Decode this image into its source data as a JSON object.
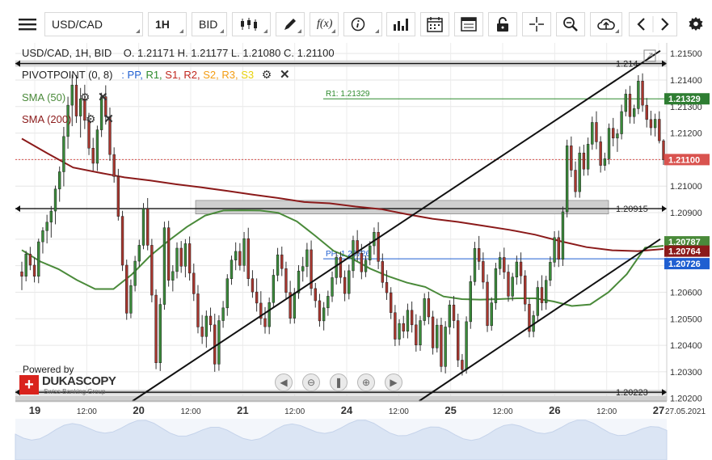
{
  "toolbar": {
    "instrument": "USD/CAD",
    "timeframe": "1H",
    "side": "BID",
    "fx_label": "f(x)",
    "info_label": "i"
  },
  "legend": {
    "ohlc_prefix": "USD/CAD, 1H, BID",
    "ohlc": "O. 1.21171 H. 1.21177 L. 1.21080 C. 1.21100",
    "pivot_name": "PIVOTPOINT (0, 8)",
    "pivot_sep": ":",
    "pivot_levels": [
      {
        "label": "PP",
        "color": "#1f5fd1"
      },
      {
        "label": "R1",
        "color": "#2e8b2e"
      },
      {
        "label": "S1",
        "color": "#c0271e"
      },
      {
        "label": "R2",
        "color": "#c0271e"
      },
      {
        "label": "S2",
        "color": "#f39c12"
      },
      {
        "label": "R3",
        "color": "#f39c12"
      },
      {
        "label": "S3",
        "color": "#e8d10a"
      }
    ],
    "sma50": "SMA (50)",
    "sma200": "SMA (200)",
    "sma50_color": "#4a8a3a",
    "sma200_color": "#8b1a1a"
  },
  "branding": {
    "powered": "Powered by",
    "logo_word": "DUKASCOPY",
    "logo_sub": "Swiss Banking Group"
  },
  "chart_data": {
    "type": "candlestick",
    "instrument": "USD/CAD",
    "timeframe": "1H",
    "ylim": [
      1.2019,
      1.2154
    ],
    "y_ticks": [
      "1.21500",
      "1.21400",
      "1.21300",
      "1.21200",
      "1.21100",
      "1.21000",
      "1.20900",
      "1.20800",
      "1.20700",
      "1.20600",
      "1.20500",
      "1.20400",
      "1.20300",
      "1.20200"
    ],
    "x_ticks": [
      {
        "label": "19",
        "bold": true
      },
      {
        "label": "12:00",
        "bold": false
      },
      {
        "label": "20",
        "bold": true
      },
      {
        "label": "12:00",
        "bold": false
      },
      {
        "label": "21",
        "bold": true
      },
      {
        "label": "12:00",
        "bold": false
      },
      {
        "label": "24",
        "bold": true
      },
      {
        "label": "12:00",
        "bold": false
      },
      {
        "label": "25",
        "bold": true
      },
      {
        "label": "12:00",
        "bold": false
      },
      {
        "label": "26",
        "bold": true
      },
      {
        "label": "12:00",
        "bold": false
      },
      {
        "label": "27",
        "bold": true
      }
    ],
    "date_label": "27.05.2021",
    "horizontal_levels": [
      {
        "value": 1.21462,
        "label": "1.214"
      },
      {
        "value": 1.20915,
        "label": "1.20915"
      },
      {
        "value": 1.20223,
        "label": "1.20223"
      }
    ],
    "pivot_r1": {
      "value": 1.21329,
      "label": "R1: 1.21329",
      "color": "#2e8b2e"
    },
    "pivot_pp": {
      "value": 1.20726,
      "label": "PP: 1.20726",
      "color": "#1f5fd1"
    },
    "price_tags": [
      {
        "value": 1.21329,
        "text": "1.21329",
        "color": "#2e7d32"
      },
      {
        "value": 1.211,
        "text": "1.21100",
        "color": "#d9534f"
      },
      {
        "value": 1.20787,
        "text": "1.20787",
        "color": "#4a8a3a"
      },
      {
        "value": 1.20764,
        "text": "1.20764",
        "color": "#8b1a1a"
      },
      {
        "value": 1.20726,
        "text": "1.20726",
        "color": "#1f5fd1"
      }
    ],
    "sma50_path": [
      [
        0.0,
        1.20759
      ],
      [
        1,
        1.20716
      ],
      [
        2,
        1.20687
      ],
      [
        3,
        1.20646
      ],
      [
        4,
        1.20612
      ],
      [
        5,
        1.20612
      ],
      [
        6,
        1.20667
      ],
      [
        7,
        1.20737
      ],
      [
        8,
        1.20794
      ],
      [
        9,
        1.20846
      ],
      [
        10,
        1.20889
      ],
      [
        11,
        1.20908
      ],
      [
        12,
        1.20909
      ],
      [
        13,
        1.20908
      ],
      [
        14,
        1.20899
      ],
      [
        15,
        1.20867
      ],
      [
        16,
        1.20813
      ],
      [
        17,
        1.20756
      ],
      [
        18,
        1.20727
      ],
      [
        19,
        1.20689
      ],
      [
        20,
        1.2066
      ],
      [
        21,
        1.20636
      ],
      [
        22,
        1.2062
      ],
      [
        23,
        1.20584
      ],
      [
        24,
        1.20574
      ],
      [
        25,
        1.20572
      ],
      [
        26,
        1.20574
      ],
      [
        27,
        1.20577
      ],
      [
        28,
        1.20577
      ],
      [
        29,
        1.20565
      ],
      [
        30,
        1.20548
      ],
      [
        31,
        1.20554
      ],
      [
        32,
        1.206
      ],
      [
        33,
        1.20668
      ],
      [
        34,
        1.20768
      ],
      [
        35,
        1.20775
      ]
    ],
    "sma200_path": [
      [
        0.0,
        1.21179
      ],
      [
        1,
        1.21123
      ],
      [
        2,
        1.2107
      ],
      [
        3,
        1.21051
      ],
      [
        4,
        1.21033
      ],
      [
        5,
        1.21021
      ],
      [
        6,
        1.21007
      ],
      [
        7,
        1.20995
      ],
      [
        8,
        1.20982
      ],
      [
        9,
        1.20968
      ],
      [
        10,
        1.20955
      ],
      [
        11,
        1.2094
      ],
      [
        12,
        1.20935
      ],
      [
        13,
        1.20923
      ],
      [
        14,
        1.20913
      ],
      [
        15,
        1.20894
      ],
      [
        16,
        1.20877
      ],
      [
        17,
        1.20865
      ],
      [
        18,
        1.2085
      ],
      [
        19,
        1.20835
      ],
      [
        20,
        1.20817
      ],
      [
        21,
        1.20792
      ],
      [
        22,
        1.2077
      ],
      [
        23,
        1.20758
      ],
      [
        24,
        1.20755
      ],
      [
        25,
        1.20763
      ]
    ],
    "trendlines": [
      {
        "from": [
          1.2019,
          0.18
        ],
        "to": [
          1.2151,
          0.99
        ]
      },
      {
        "from": [
          1.2019,
          0.62
        ],
        "to": [
          1.208,
          0.99
        ]
      }
    ],
    "candles": [
      [
        1.20677,
        1.20715,
        1.20608,
        1.2066
      ],
      [
        1.2066,
        1.20756,
        1.20641,
        1.20744
      ],
      [
        1.20744,
        1.20771,
        1.20683,
        1.20702
      ],
      [
        1.20702,
        1.20731,
        1.20637,
        1.2066
      ],
      [
        1.2066,
        1.20802,
        1.20634,
        1.2079
      ],
      [
        1.2079,
        1.20845,
        1.20746,
        1.20832
      ],
      [
        1.20832,
        1.20892,
        1.20784,
        1.20864
      ],
      [
        1.20864,
        1.20925,
        1.20806,
        1.20906
      ],
      [
        1.20906,
        1.21002,
        1.20856,
        1.20989
      ],
      [
        1.20989,
        1.21074,
        1.20941,
        1.21054
      ],
      [
        1.21054,
        1.21223,
        1.20999,
        1.21187
      ],
      [
        1.21187,
        1.21337,
        1.21141,
        1.21305
      ],
      [
        1.21305,
        1.2142,
        1.21226,
        1.21381
      ],
      [
        1.21381,
        1.21418,
        1.21238,
        1.21264
      ],
      [
        1.21264,
        1.2137,
        1.21183,
        1.21329
      ],
      [
        1.21329,
        1.21382,
        1.21215,
        1.21248
      ],
      [
        1.21248,
        1.21276,
        1.21117,
        1.21143
      ],
      [
        1.21143,
        1.21182,
        1.21058,
        1.21086
      ],
      [
        1.21086,
        1.21228,
        1.21057,
        1.21212
      ],
      [
        1.21212,
        1.21352,
        1.21185,
        1.21337
      ],
      [
        1.21337,
        1.2138,
        1.21232,
        1.21262
      ],
      [
        1.21262,
        1.21296,
        1.21095,
        1.21119
      ],
      [
        1.21119,
        1.21146,
        1.21013,
        1.21036
      ],
      [
        1.21036,
        1.21065,
        1.2087,
        1.20886
      ],
      [
        1.20886,
        1.20907,
        1.2068,
        1.20702
      ],
      [
        1.20702,
        1.20723,
        1.20496,
        1.20521
      ],
      [
        1.20521,
        1.20648,
        1.20502,
        1.20625
      ],
      [
        1.20625,
        1.20737,
        1.20603,
        1.20717
      ],
      [
        1.20717,
        1.20798,
        1.20696,
        1.20777
      ],
      [
        1.20777,
        1.20936,
        1.20762,
        1.20915
      ],
      [
        1.20915,
        1.20955,
        1.20758,
        1.20777
      ],
      [
        1.20777,
        1.20801,
        1.20562,
        1.20589
      ],
      [
        1.20589,
        1.20611,
        1.2031,
        1.20334
      ],
      [
        1.20334,
        1.20578,
        1.20303,
        1.20554
      ],
      [
        1.20554,
        1.20866,
        1.20534,
        1.20843
      ],
      [
        1.20843,
        1.20869,
        1.20621,
        1.20645
      ],
      [
        1.20645,
        1.20702,
        1.20603,
        1.20678
      ],
      [
        1.20678,
        1.20788,
        1.20652,
        1.20766
      ],
      [
        1.20766,
        1.20793,
        1.20673,
        1.20698
      ],
      [
        1.20698,
        1.208,
        1.20656,
        1.20783
      ],
      [
        1.20783,
        1.2081,
        1.20644,
        1.20672
      ],
      [
        1.20672,
        1.20708,
        1.20567,
        1.20594
      ],
      [
        1.20594,
        1.20627,
        1.20445,
        1.20469
      ],
      [
        1.20469,
        1.20514,
        1.20405,
        1.20433
      ],
      [
        1.20433,
        1.20531,
        1.20391,
        1.2051
      ],
      [
        1.2051,
        1.20542,
        1.20451,
        1.20477
      ],
      [
        1.20477,
        1.20519,
        1.203,
        1.20329
      ],
      [
        1.20329,
        1.20513,
        1.20304,
        1.20493
      ],
      [
        1.20493,
        1.20567,
        1.20466,
        1.20541
      ],
      [
        1.20541,
        1.20668,
        1.20511,
        1.20651
      ],
      [
        1.20651,
        1.20738,
        1.20628,
        1.20721
      ],
      [
        1.20721,
        1.20788,
        1.20683,
        1.20754
      ],
      [
        1.20754,
        1.20785,
        1.20682,
        1.20701
      ],
      [
        1.20701,
        1.20827,
        1.20677,
        1.20802
      ],
      [
        1.20802,
        1.20843,
        1.20623,
        1.20651
      ],
      [
        1.20651,
        1.20683,
        1.20579,
        1.20601
      ],
      [
        1.20601,
        1.20652,
        1.20527,
        1.20559
      ],
      [
        1.20559,
        1.20604,
        1.20477,
        1.20501
      ],
      [
        1.20501,
        1.20544,
        1.20444,
        1.2047
      ],
      [
        1.2047,
        1.2058,
        1.20442,
        1.20561
      ],
      [
        1.20561,
        1.20687,
        1.20543,
        1.20664
      ],
      [
        1.20664,
        1.20767,
        1.20641,
        1.20741
      ],
      [
        1.20741,
        1.20772,
        1.20661,
        1.20689
      ],
      [
        1.20689,
        1.20715,
        1.20575,
        1.20599
      ],
      [
        1.20599,
        1.20643,
        1.20481,
        1.20502
      ],
      [
        1.20502,
        1.20616,
        1.20482,
        1.20597
      ],
      [
        1.20597,
        1.20702,
        1.20575,
        1.2068
      ],
      [
        1.2068,
        1.20733,
        1.2064,
        1.20697
      ],
      [
        1.20697,
        1.20786,
        1.20657,
        1.2076
      ],
      [
        1.2076,
        1.20795,
        1.20588,
        1.20614
      ],
      [
        1.20614,
        1.20635,
        1.20542,
        1.20568
      ],
      [
        1.20568,
        1.20594,
        1.2047,
        1.20492
      ],
      [
        1.20492,
        1.20563,
        1.20456,
        1.20541
      ],
      [
        1.20541,
        1.20606,
        1.20511,
        1.20585
      ],
      [
        1.20585,
        1.20678,
        1.20563,
        1.20655
      ],
      [
        1.20655,
        1.20751,
        1.20629,
        1.20732
      ],
      [
        1.20732,
        1.20753,
        1.20633,
        1.20656
      ],
      [
        1.20656,
        1.20682,
        1.20566,
        1.20595
      ],
      [
        1.20595,
        1.20704,
        1.20573,
        1.20681
      ],
      [
        1.20681,
        1.20813,
        1.20654,
        1.20795
      ],
      [
        1.20795,
        1.20834,
        1.20717,
        1.20747
      ],
      [
        1.20747,
        1.20782,
        1.20649,
        1.20677
      ],
      [
        1.20677,
        1.20738,
        1.20657,
        1.20721
      ],
      [
        1.20721,
        1.20792,
        1.20702,
        1.20775
      ],
      [
        1.20775,
        1.20844,
        1.20742,
        1.20826
      ],
      [
        1.20826,
        1.20864,
        1.20687,
        1.20716
      ],
      [
        1.20716,
        1.20746,
        1.20616,
        1.20637
      ],
      [
        1.20637,
        1.20683,
        1.20571,
        1.20598
      ],
      [
        1.20598,
        1.20619,
        1.20499,
        1.20523
      ],
      [
        1.20523,
        1.20552,
        1.20397,
        1.20423
      ],
      [
        1.20423,
        1.20498,
        1.20399,
        1.20482
      ],
      [
        1.20482,
        1.20511,
        1.20427,
        1.20453
      ],
      [
        1.20453,
        1.20557,
        1.20426,
        1.20532
      ],
      [
        1.20532,
        1.20565,
        1.20448,
        1.20477
      ],
      [
        1.20477,
        1.20517,
        1.20376,
        1.20401
      ],
      [
        1.20401,
        1.20511,
        1.20379,
        1.20493
      ],
      [
        1.20493,
        1.20596,
        1.20475,
        1.20576
      ],
      [
        1.20576,
        1.20602,
        1.20479,
        1.20507
      ],
      [
        1.20507,
        1.2053,
        1.20365,
        1.2039
      ],
      [
        1.2039,
        1.205,
        1.20373,
        1.20476
      ],
      [
        1.20476,
        1.20504,
        1.20299,
        1.2032
      ],
      [
        1.2032,
        1.20491,
        1.20294,
        1.20469
      ],
      [
        1.20469,
        1.2057,
        1.20441,
        1.20552
      ],
      [
        1.20552,
        1.20586,
        1.20464,
        1.20493
      ],
      [
        1.20493,
        1.20519,
        1.20318,
        1.20344
      ],
      [
        1.20344,
        1.20367,
        1.20286,
        1.20308
      ],
      [
        1.20308,
        1.20509,
        1.20293,
        1.20489
      ],
      [
        1.20489,
        1.20663,
        1.20462,
        1.2064
      ],
      [
        1.2064,
        1.2079,
        1.20625,
        1.20765
      ],
      [
        1.20765,
        1.20812,
        1.20684,
        1.20716
      ],
      [
        1.20716,
        1.2075,
        1.20612,
        1.20638
      ],
      [
        1.20638,
        1.20667,
        1.2045,
        1.20474
      ],
      [
        1.20474,
        1.20581,
        1.20455,
        1.2056
      ],
      [
        1.2056,
        1.20711,
        1.20534,
        1.20689
      ],
      [
        1.20689,
        1.20752,
        1.20665,
        1.20731
      ],
      [
        1.20731,
        1.20768,
        1.2065,
        1.20676
      ],
      [
        1.20676,
        1.20704,
        1.20564,
        1.20585
      ],
      [
        1.20585,
        1.20673,
        1.20567,
        1.20657
      ],
      [
        1.20657,
        1.20738,
        1.20628,
        1.20714
      ],
      [
        1.20714,
        1.2075,
        1.20631,
        1.20662
      ],
      [
        1.20662,
        1.20683,
        1.20528,
        1.20555
      ],
      [
        1.20555,
        1.20578,
        1.2043,
        1.20452
      ],
      [
        1.20452,
        1.2053,
        1.2043,
        1.20512
      ],
      [
        1.20512,
        1.20643,
        1.20491,
        1.20618
      ],
      [
        1.20618,
        1.20664,
        1.20531,
        1.2056
      ],
      [
        1.2056,
        1.20662,
        1.20534,
        1.20645
      ],
      [
        1.20645,
        1.20735,
        1.20623,
        1.20713
      ],
      [
        1.20713,
        1.2083,
        1.20695,
        1.20806
      ],
      [
        1.20806,
        1.20832,
        1.20695,
        1.20724
      ],
      [
        1.20724,
        1.20923,
        1.20699,
        1.20903
      ],
      [
        1.20903,
        1.21175,
        1.20882,
        1.21152
      ],
      [
        1.21152,
        1.21187,
        1.21034,
        1.2106
      ],
      [
        1.2106,
        1.21093,
        1.20957,
        1.20979
      ],
      [
        1.20979,
        1.21149,
        1.20956,
        1.21125
      ],
      [
        1.21125,
        1.21156,
        1.21039,
        1.21064
      ],
      [
        1.21064,
        1.21183,
        1.2104,
        1.21158
      ],
      [
        1.21158,
        1.21262,
        1.21137,
        1.2124
      ],
      [
        1.2124,
        1.21282,
        1.21139,
        1.21167
      ],
      [
        1.21167,
        1.21188,
        1.21051,
        1.21078
      ],
      [
        1.21078,
        1.21126,
        1.21058,
        1.21103
      ],
      [
        1.21103,
        1.21236,
        1.21082,
        1.21218
      ],
      [
        1.21218,
        1.21257,
        1.2115,
        1.21181
      ],
      [
        1.21181,
        1.21215,
        1.21129,
        1.21197
      ],
      [
        1.21197,
        1.21307,
        1.21176,
        1.21281
      ],
      [
        1.21281,
        1.21365,
        1.21263,
        1.21347
      ],
      [
        1.21347,
        1.21378,
        1.21236,
        1.21262
      ],
      [
        1.21262,
        1.21307,
        1.21235,
        1.21292
      ],
      [
        1.21292,
        1.21418,
        1.21271,
        1.21396
      ],
      [
        1.21396,
        1.21425,
        1.2128,
        1.21305
      ],
      [
        1.21305,
        1.21332,
        1.21221,
        1.21251
      ],
      [
        1.21251,
        1.21284,
        1.21191,
        1.2122
      ],
      [
        1.2122,
        1.21273,
        1.21187,
        1.21252
      ],
      [
        1.21252,
        1.21282,
        1.21161,
        1.21171
      ],
      [
        1.21171,
        1.21177,
        1.2108,
        1.211
      ]
    ]
  }
}
